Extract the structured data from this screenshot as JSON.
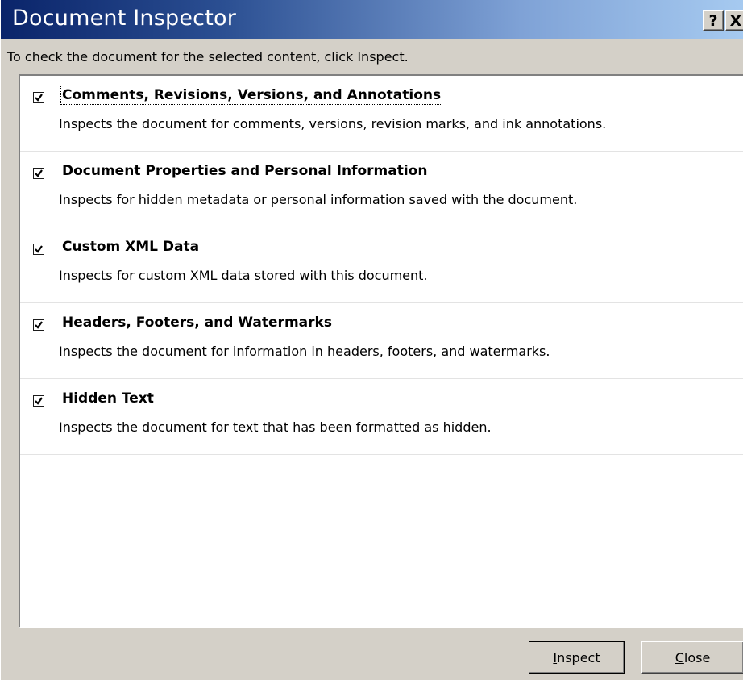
{
  "window": {
    "title": "Document Inspector",
    "help_label": "?",
    "close_label": "X"
  },
  "instruction": "To check the document for the selected content, click Inspect.",
  "items": [
    {
      "title": "Comments, Revisions, Versions, and Annotations",
      "description": "Inspects the document for comments, versions, revision marks, and ink annotations.",
      "checked": true
    },
    {
      "title": "Document Properties and Personal Information",
      "description": "Inspects for hidden metadata or personal information saved with the document.",
      "checked": true
    },
    {
      "title": "Custom XML Data",
      "description": "Inspects for custom XML data stored with this document.",
      "checked": true
    },
    {
      "title": "Headers, Footers, and Watermarks",
      "description": "Inspects the document for information in headers, footers, and watermarks.",
      "checked": true
    },
    {
      "title": "Hidden Text",
      "description": "Inspects the document for text that has been formatted as hidden.",
      "checked": true
    }
  ],
  "buttons": {
    "inspect_accel": "I",
    "inspect_rest": "nspect",
    "close_accel": "C",
    "close_rest": "lose"
  }
}
